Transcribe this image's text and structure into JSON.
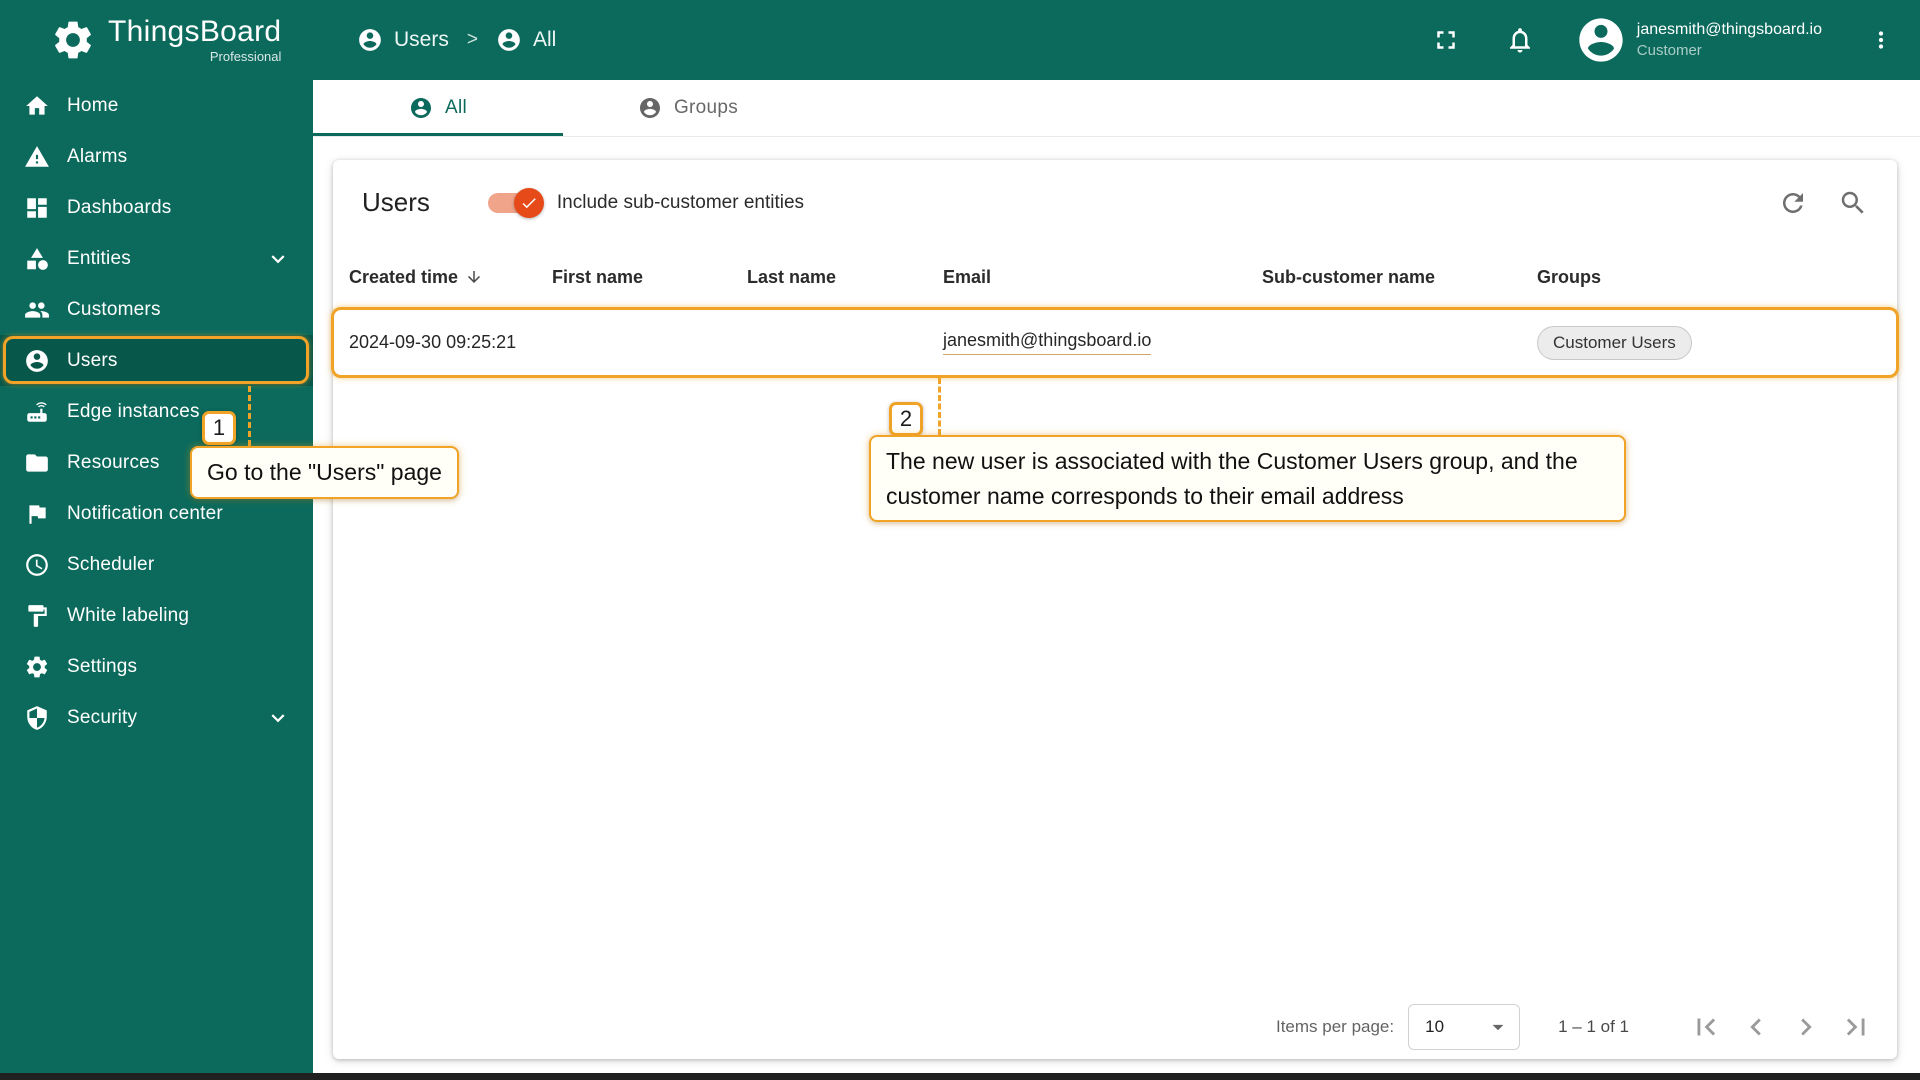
{
  "app": {
    "brand": "ThingsBoard",
    "brand_sub": "Professional"
  },
  "header": {
    "breadcrumb": {
      "items": [
        {
          "label": "Users"
        },
        {
          "label": "All"
        }
      ],
      "separator": ">"
    },
    "user": {
      "email": "janesmith@thingsboard.io",
      "role": "Customer"
    }
  },
  "sidebar": {
    "items": [
      {
        "label": "Home",
        "icon": "home-icon"
      },
      {
        "label": "Alarms",
        "icon": "alarm-icon"
      },
      {
        "label": "Dashboards",
        "icon": "dashboards-icon"
      },
      {
        "label": "Entities",
        "icon": "entities-icon",
        "expandable": true
      },
      {
        "label": "Customers",
        "icon": "customers-icon"
      },
      {
        "label": "Users",
        "icon": "users-icon",
        "active": true
      },
      {
        "label": "Edge instances",
        "icon": "edge-instances-icon"
      },
      {
        "label": "Resources",
        "icon": "resources-icon"
      },
      {
        "label": "Notification center",
        "icon": "notification-icon"
      },
      {
        "label": "Scheduler",
        "icon": "scheduler-icon"
      },
      {
        "label": "White labeling",
        "icon": "white-labeling-icon"
      },
      {
        "label": "Settings",
        "icon": "settings-icon"
      },
      {
        "label": "Security",
        "icon": "security-icon",
        "expandable": true
      }
    ]
  },
  "tabs": [
    {
      "label": "All",
      "active": true
    },
    {
      "label": "Groups",
      "active": false
    }
  ],
  "panel": {
    "title": "Users",
    "toggle_label": "Include sub-customer entities",
    "toggle_checked": true
  },
  "table": {
    "columns": [
      "Created time",
      "First name",
      "Last name",
      "Email",
      "Sub-customer name",
      "Groups"
    ],
    "sorted_by": "Created time",
    "sort_direction": "desc",
    "rows": [
      {
        "created_time": "2024-09-30 09:25:21",
        "first_name": "",
        "last_name": "",
        "email": "janesmith@thingsboard.io",
        "sub_customer": "",
        "groups": [
          "Customer Users"
        ]
      }
    ]
  },
  "pagination": {
    "items_per_page_label": "Items per page:",
    "items_per_page": "10",
    "range": "1 – 1 of 1"
  },
  "annotations": {
    "step1": {
      "number": "1",
      "text": "Go to the \"Users\" page"
    },
    "step2": {
      "number": "2",
      "text": "The new user is associated with the Customer Users group, and the customer name corresponds to their email address"
    }
  },
  "colors": {
    "primary": "#0B6A5C",
    "annotation": "#F0A326",
    "toggle": "#E64A19"
  }
}
